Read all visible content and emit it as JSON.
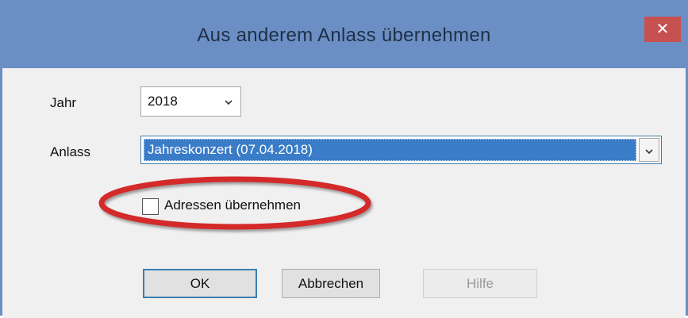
{
  "dialog": {
    "title": "Aus anderem Anlass übernehmen",
    "close_label": "✕"
  },
  "form": {
    "year_label": "Jahr",
    "year_value": "2018",
    "event_label": "Anlass",
    "event_value": "Jahreskonzert (07.04.2018)",
    "addresses_checkbox_label": "Adressen übernehmen",
    "addresses_checked": false
  },
  "buttons": {
    "ok": "OK",
    "cancel": "Abbrechen",
    "help": "Hilfe"
  },
  "colors": {
    "titlebar": "#6b8fc4",
    "close": "#c75050",
    "selection": "#3a7cc7",
    "highlight_ellipse": "#d42a2a"
  }
}
